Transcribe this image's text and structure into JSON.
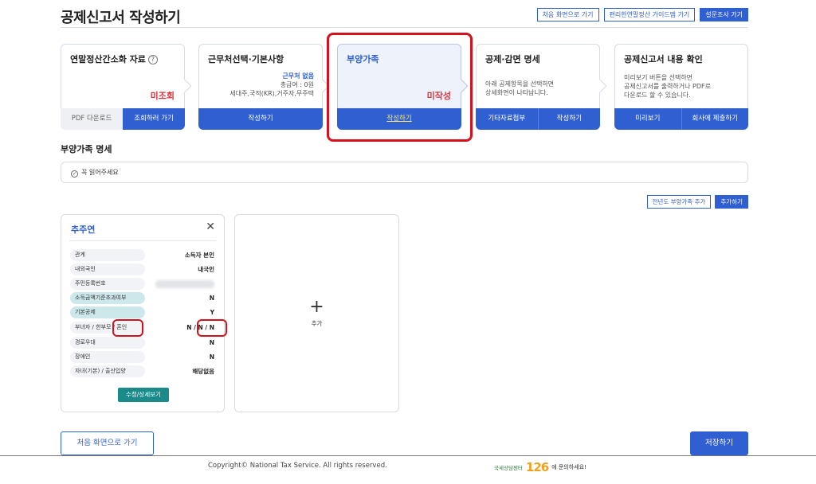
{
  "page": {
    "title": "공제신고서 작성하기"
  },
  "top_buttons": [
    "처음 화면으로 가기",
    "편리한연말정산 가이드맵 가기",
    "설문조사 가기"
  ],
  "steps": {
    "s1": {
      "title": "연말정산간소화 자료",
      "help": "?",
      "status": "미조회",
      "btn_left": "PDF 다운로드",
      "btn_right": "조회하러 가기"
    },
    "s2": {
      "title": "근무처선택·기본사항",
      "info1": "근무처 없음",
      "info2": "총급여 : 0원",
      "info3": "세대주,국적(KR),거주자,무주택",
      "btn": "작성하기"
    },
    "s3": {
      "title": "부양가족",
      "status": "미작성",
      "btn": "작성하기"
    },
    "s4": {
      "title": "공제·감면 명세",
      "desc1": "아래 공제항목을 선택하면",
      "desc2": "상세화면이 나타납니다.",
      "btn_left": "기타자료첨부",
      "btn_right": "작성하기"
    },
    "s5": {
      "title": "공제신고서 내용 확인",
      "desc1": "미리보기 버튼을 선택하면",
      "desc2": "공제신고서를 출력하거나 PDF로",
      "desc3": "다운로드 할 수 있습니다.",
      "btn_left": "미리보기",
      "btn_right": "회사에 제출하기"
    }
  },
  "section": {
    "title": "부양가족 명세",
    "notice": "꼭 읽어주세요",
    "btn_prev_year": "전년도 부양가족 추가",
    "btn_add": "추가하기"
  },
  "dependent": {
    "name": "추주연",
    "close": "✕",
    "rows": [
      {
        "label": "관계",
        "value": "소득자 본인"
      },
      {
        "label": "내외국인",
        "value": "내국인"
      },
      {
        "label": "주민등록번호",
        "value": ""
      },
      {
        "label": "소득금액기준초과여부",
        "value": "N"
      },
      {
        "label": "기본공제",
        "value": "Y"
      },
      {
        "label": "부녀자 / 한부모 / 혼인",
        "value": "N / N / N"
      },
      {
        "label": "경로우대",
        "value": "N"
      },
      {
        "label": "장애인",
        "value": "N"
      },
      {
        "label": "자녀(기본) / 출산입양",
        "value": "해당없음"
      }
    ],
    "edit_btn": "수정/상세보기"
  },
  "add_card": {
    "plus": "+",
    "label": "추가"
  },
  "bottom": {
    "home": "처음 화면으로 가기",
    "save": "저장하기"
  },
  "footer": {
    "copyright": "Copyright© National Tax Service. All rights reserved.",
    "cc_logo": "국세상담센터",
    "cc_num": "126",
    "cc_text": "에 문의하세요!"
  },
  "colors": {
    "primary": "#2f5fd0",
    "alert": "#e0333a",
    "highlight": "#d4121e",
    "teal": "#1b8a8a"
  }
}
